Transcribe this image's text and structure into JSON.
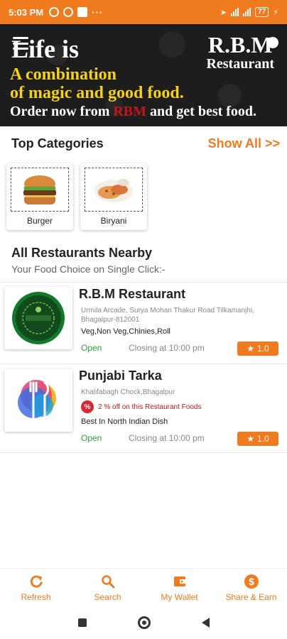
{
  "status_bar": {
    "time": "5:03 PM",
    "battery": "77",
    "dots": "···"
  },
  "banner": {
    "line1": "Life is",
    "line2": "A combination",
    "line3": "of magic and good food.",
    "line4_prefix": "Order now from ",
    "line4_highlight": "RBM",
    "line4_suffix": " and get best food.",
    "brand_name": "R.B.M",
    "brand_sub": "Restaurant"
  },
  "categories": {
    "title": "Top Categories",
    "show_all": "Show All >>",
    "items": [
      {
        "label": "Burger"
      },
      {
        "label": "Biryani"
      }
    ]
  },
  "nearby": {
    "title": "All Restaurants Nearby",
    "subtitle": "Your Food Choice on Single Click:-"
  },
  "restaurants": [
    {
      "name": "R.B.M Restaurant",
      "address": "Urmila Arcade, Surya Mohan Thakur Road Tilkamanjhi, Bhagalpur-812001",
      "tags": "Veg,Non Veg,Chinies,Roll",
      "status": "Open",
      "closing": "Closing at 10:00 pm",
      "rating": "1.0"
    },
    {
      "name": "Punjabi Tarka",
      "address": "Khalifabagh Chock,Bhagalpur",
      "offer": "2 % off on this Restaurant Foods",
      "offer_icon": "%",
      "tags": "Best In North Indian Dish",
      "status": "Open",
      "closing": "Closing at 10:00 pm",
      "rating": "1.0"
    }
  ],
  "bottom_nav": [
    {
      "label": "Refresh",
      "icon": "refresh-icon"
    },
    {
      "label": "Search",
      "icon": "search-icon"
    },
    {
      "label": "My Wallet",
      "icon": "wallet-icon"
    },
    {
      "label": "Share & Earn",
      "icon": "dollar-icon"
    }
  ],
  "colors": {
    "accent": "#f07a1e",
    "open_green": "#2e9d3a",
    "banner_yellow": "#f5d312",
    "banner_red": "#c4161c"
  }
}
